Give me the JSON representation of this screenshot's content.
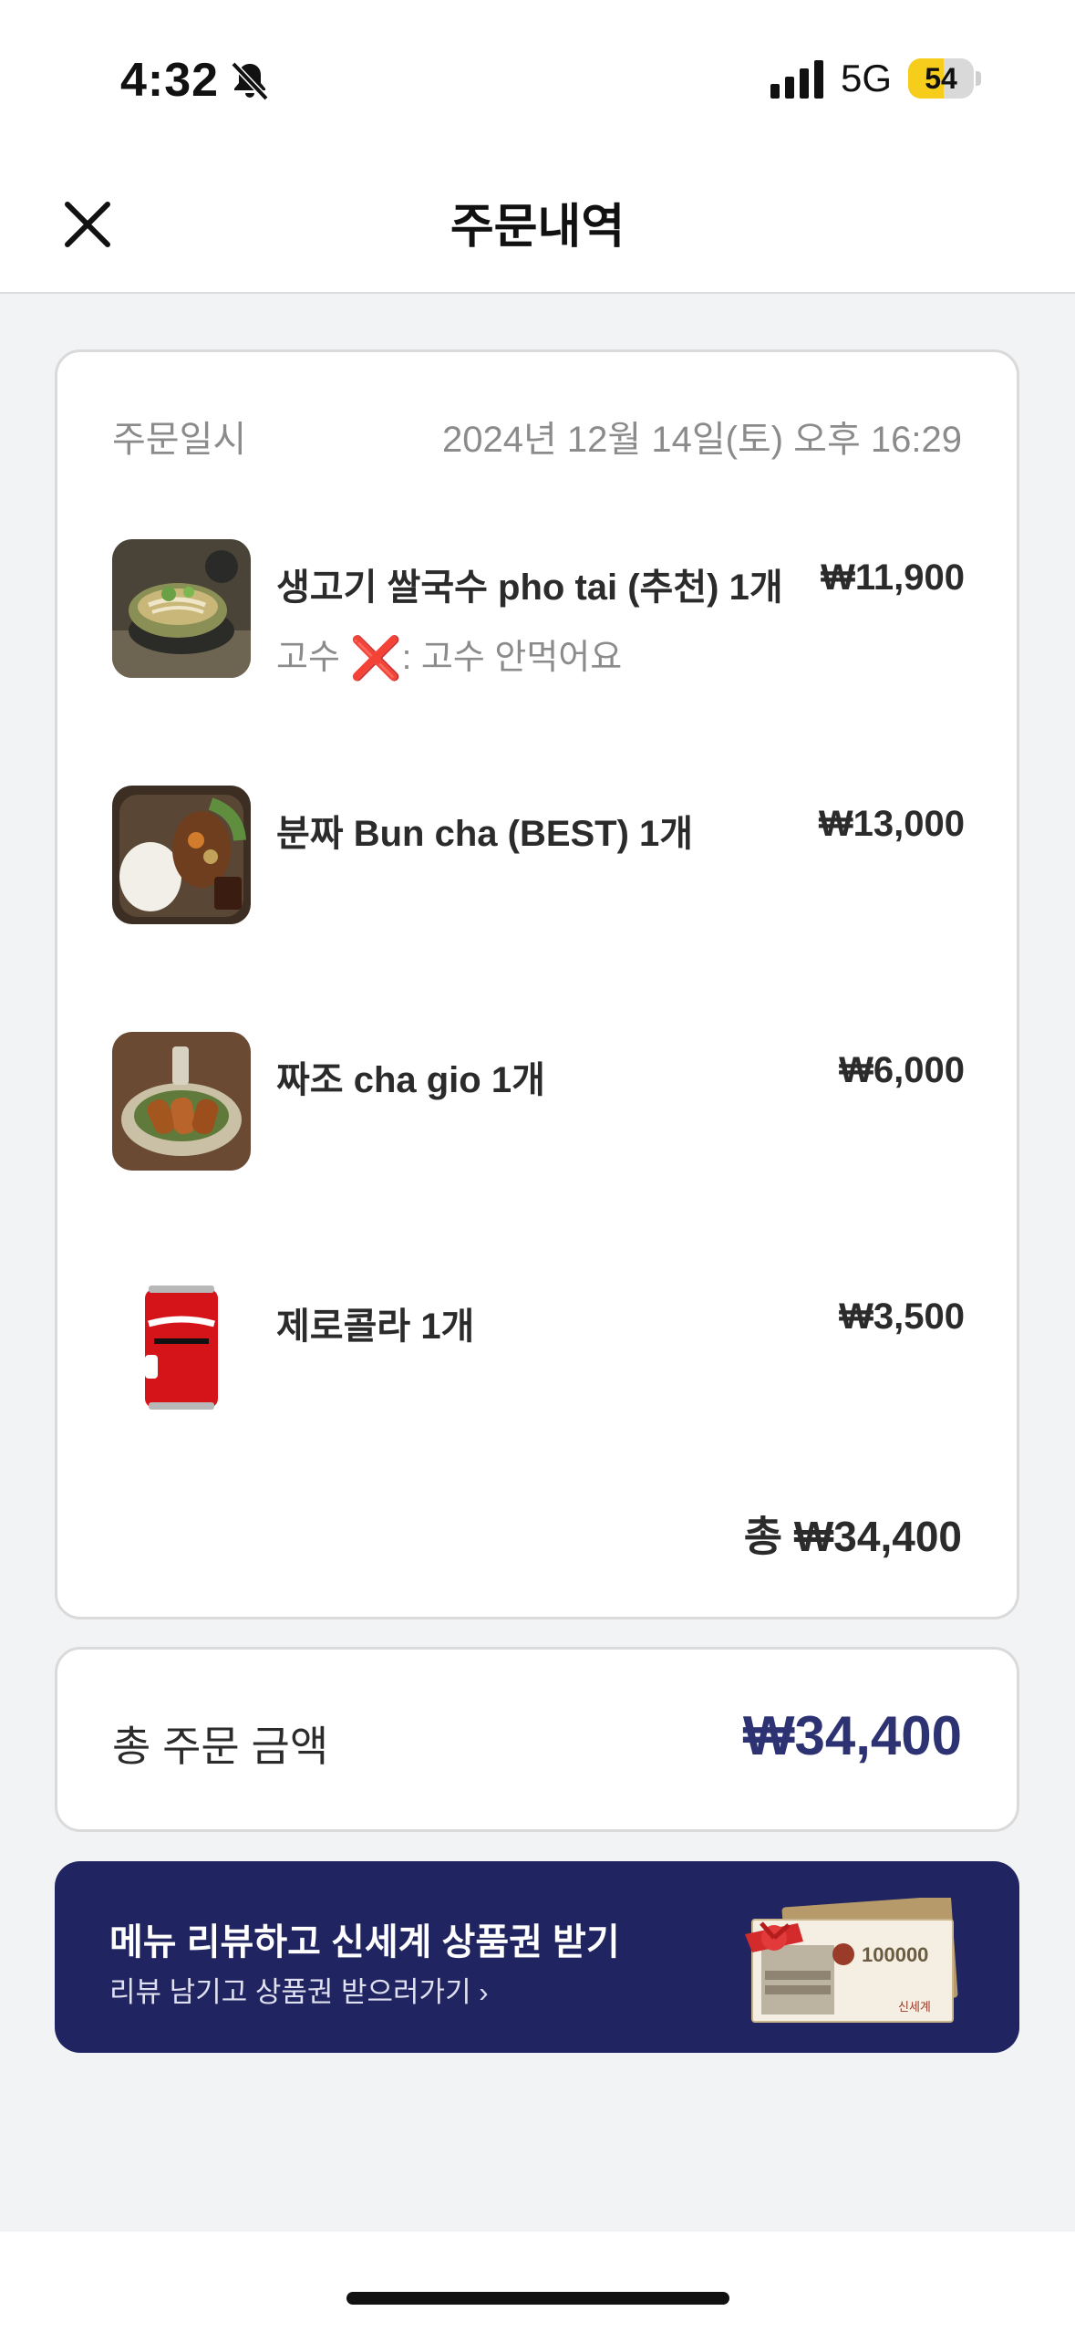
{
  "status_bar": {
    "time": "4:32",
    "network": "5G",
    "battery_level": "54",
    "battery_fraction": 0.54,
    "icons": [
      "bell-muted-icon",
      "signal-bars-icon",
      "battery-icon"
    ]
  },
  "header": {
    "title": "주문내역",
    "close_icon": "close-icon"
  },
  "order": {
    "date_label": "주문일시",
    "date_value": "2024년 12월 14일(토) 오후 16:29",
    "items": [
      {
        "name": "생고기 쌀국수 pho tai (추천) 1개",
        "price": "₩11,900",
        "option_prefix": "고수 ",
        "option_icon": "❌",
        "option_suffix": ": 고수 안먹어요"
      },
      {
        "name": "분짜 Bun cha (BEST) 1개",
        "price": "₩13,000"
      },
      {
        "name": "짜조 cha gio 1개",
        "price": "₩6,000"
      },
      {
        "name": "제로콜라 1개",
        "price": "₩3,500"
      }
    ],
    "total_line": "총 ₩34,400"
  },
  "summary": {
    "label": "총 주문 금액",
    "value": "₩34,400"
  },
  "banner": {
    "title": "메뉴 리뷰하고 신세계 상품권 받기",
    "subtitle": "리뷰 남기고 상품권 받으러가기 ›",
    "voucher_amount": "100000",
    "voucher_brand": "신세계"
  },
  "colors": {
    "accent": "#2d3273",
    "banner_bg": "#202460",
    "battery": "#f7cd1b",
    "cancel_mark": "#e02020"
  }
}
